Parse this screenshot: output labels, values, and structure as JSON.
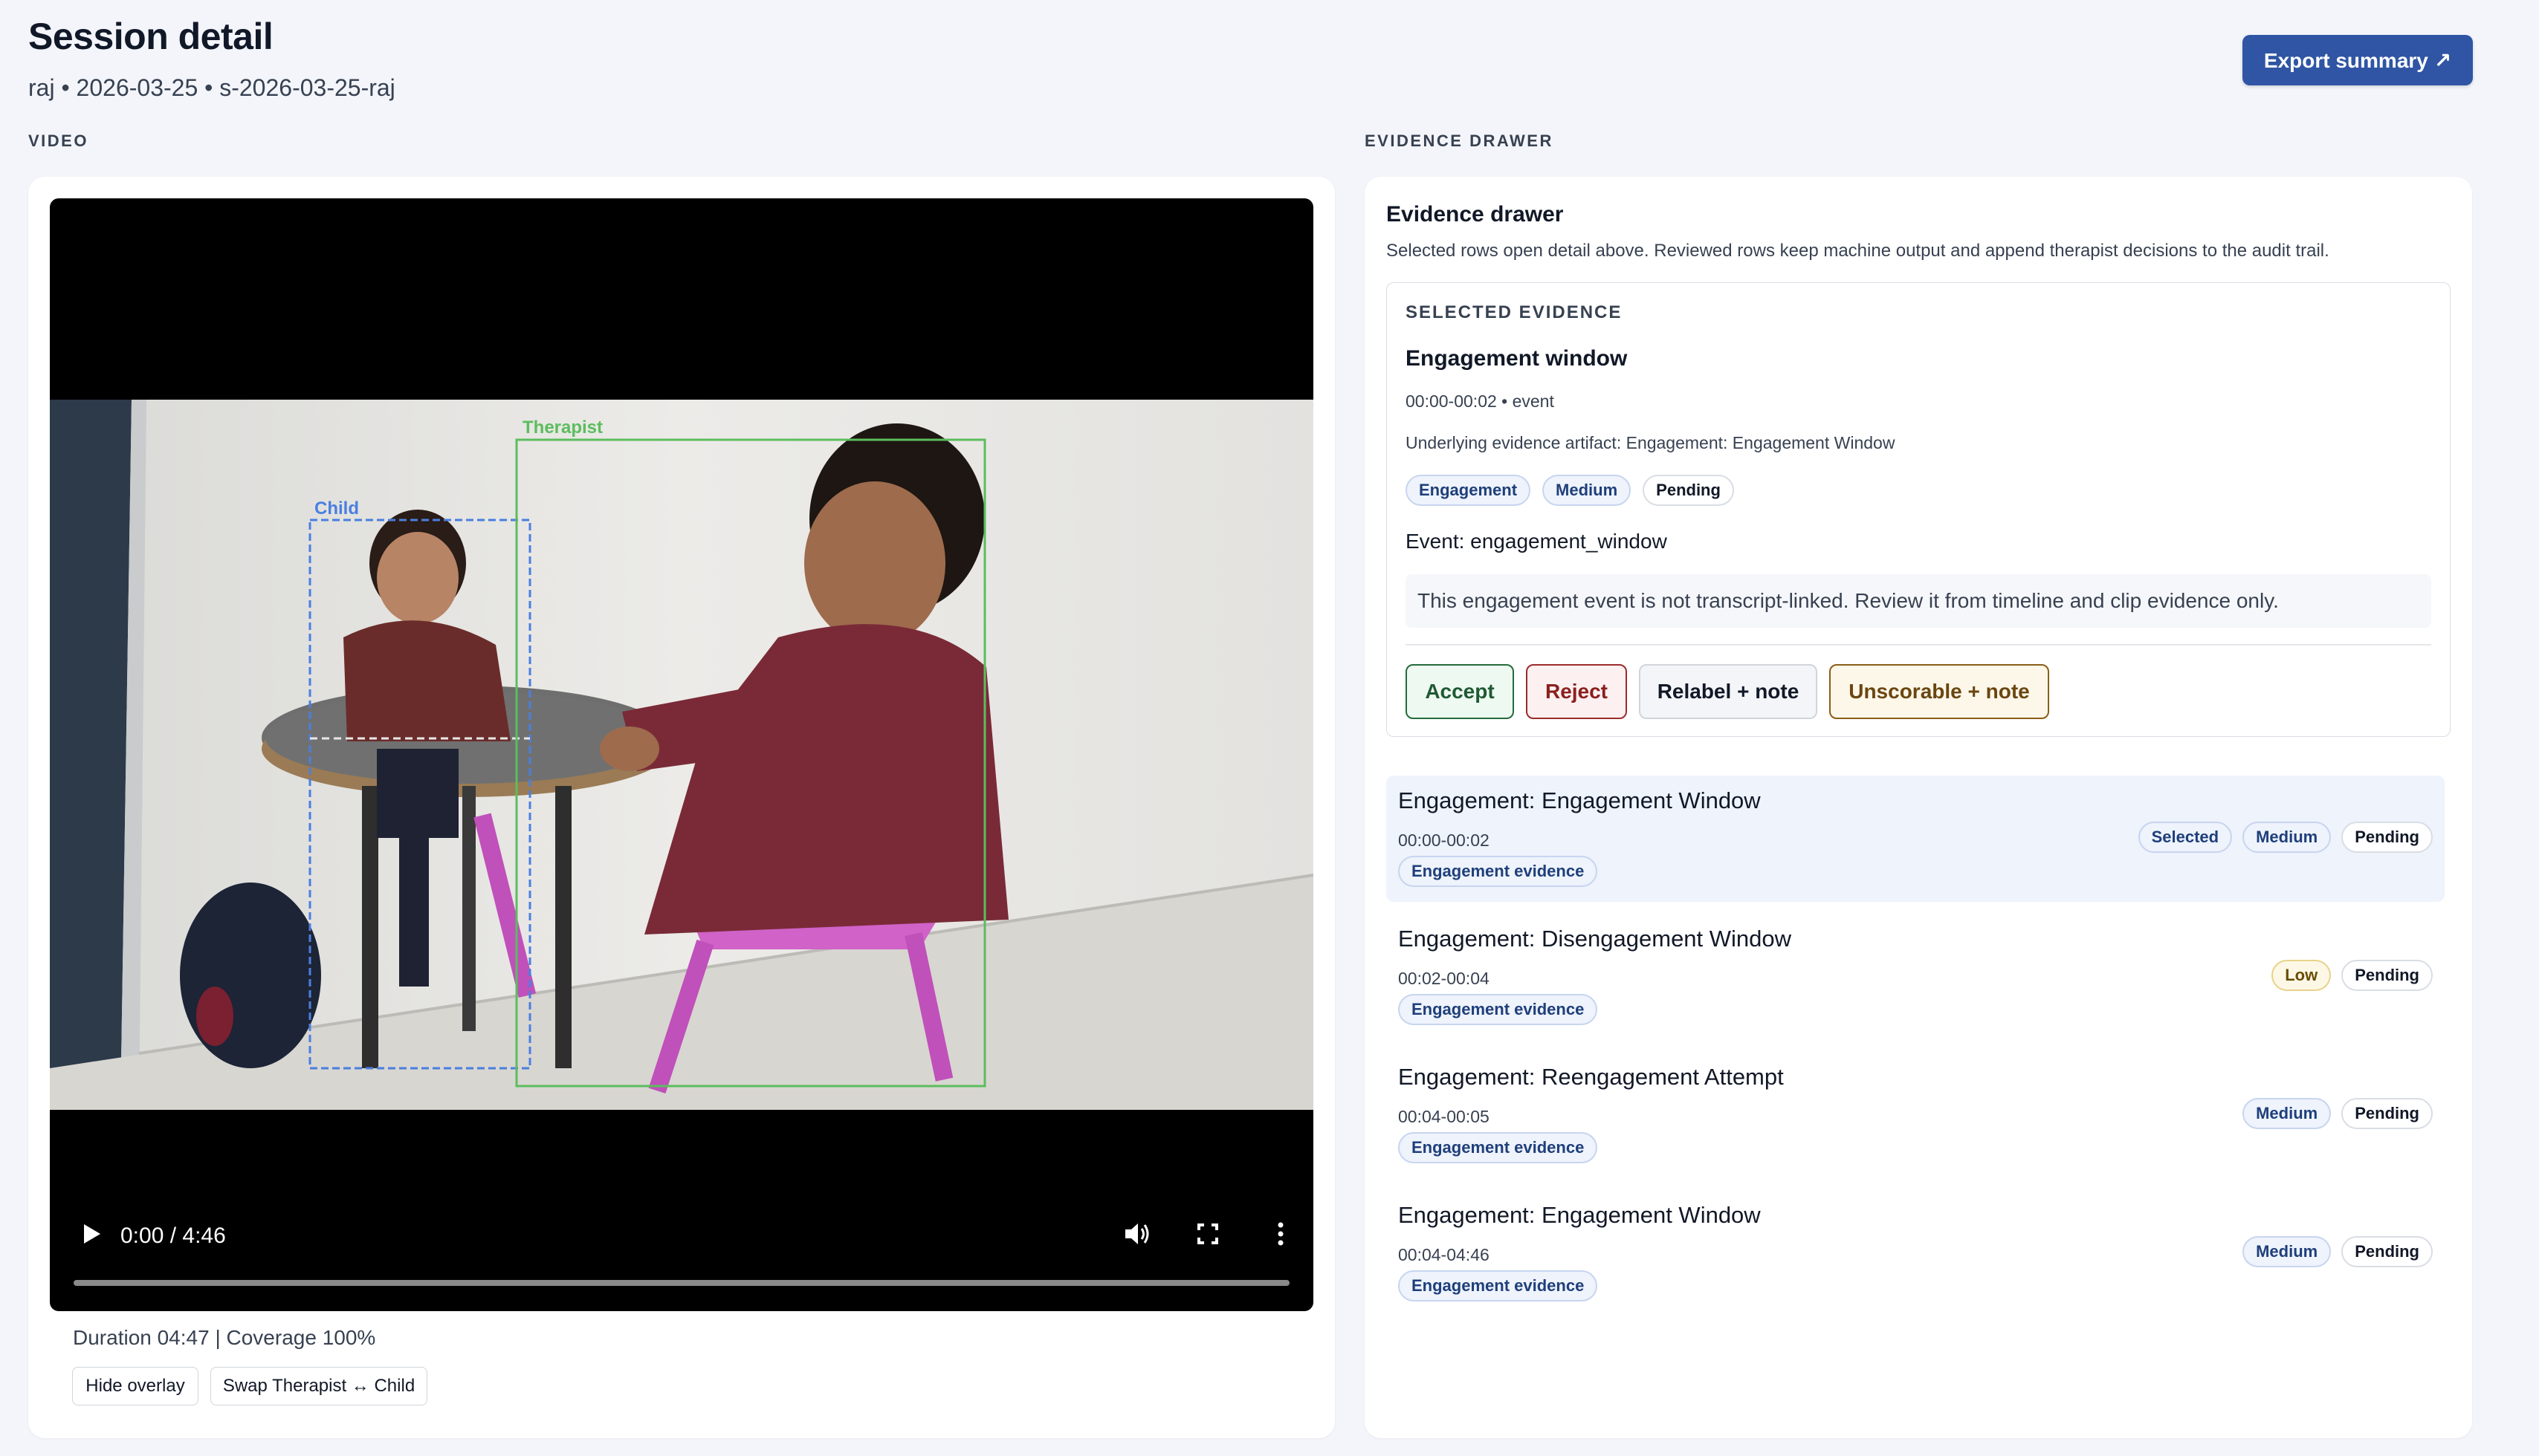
{
  "header": {
    "title": "Session detail",
    "meta": "raj • 2026-03-25 • s-2026-03-25-raj",
    "export_label": "Export summary ↗"
  },
  "video": {
    "section_label": "VIDEO",
    "overlay": {
      "therapist_label": "Therapist",
      "child_label": "Child",
      "therapist_color": "#4caf50",
      "child_color": "#4a7fe0"
    },
    "time": "0:00 / 4:46",
    "info": "Duration 04:47 | Coverage 100%",
    "hide_overlay_label": "Hide overlay",
    "swap_label": "Swap Therapist ↔ Child",
    "controls": [
      "play-icon",
      "volume-icon",
      "fullscreen-icon",
      "more-vertical-icon"
    ]
  },
  "evidence": {
    "section_label": "EVIDENCE DRAWER",
    "title": "Evidence drawer",
    "description": "Selected rows open detail above. Reviewed rows keep machine output and append therapist decisions to the audit trail.",
    "selected": {
      "label": "SELECTED EVIDENCE",
      "title": "Engagement window",
      "time": "00:00-00:02 • event",
      "artifact": "Underlying evidence artifact: Engagement: Engagement Window",
      "tags": [
        "Engagement",
        "Medium",
        "Pending"
      ],
      "event": "Event: engagement_window",
      "notice": "This engagement event is not transcript-linked. Review it from timeline and clip evidence only.",
      "actions": {
        "accept": "Accept",
        "reject": "Reject",
        "relabel": "Relabel + note",
        "unscorable": "Unscorable + note"
      }
    },
    "rows": [
      {
        "title": "Engagement: Engagement Window",
        "time": "00:00-00:02",
        "tag": "Engagement evidence",
        "selected": "Selected",
        "confidence": "Medium",
        "status": "Pending"
      },
      {
        "title": "Engagement: Disengagement Window",
        "time": "00:02-00:04",
        "tag": "Engagement evidence",
        "confidence": "Low",
        "status": "Pending"
      },
      {
        "title": "Engagement: Reengagement Attempt",
        "time": "00:04-00:05",
        "tag": "Engagement evidence",
        "confidence": "Medium",
        "status": "Pending"
      },
      {
        "title": "Engagement: Engagement Window",
        "time": "00:04-04:46",
        "tag": "Engagement evidence",
        "confidence": "Medium",
        "status": "Pending"
      }
    ]
  },
  "colors": {
    "accent": "#2f55a4",
    "selected_row_bg": "#eef3fc"
  }
}
